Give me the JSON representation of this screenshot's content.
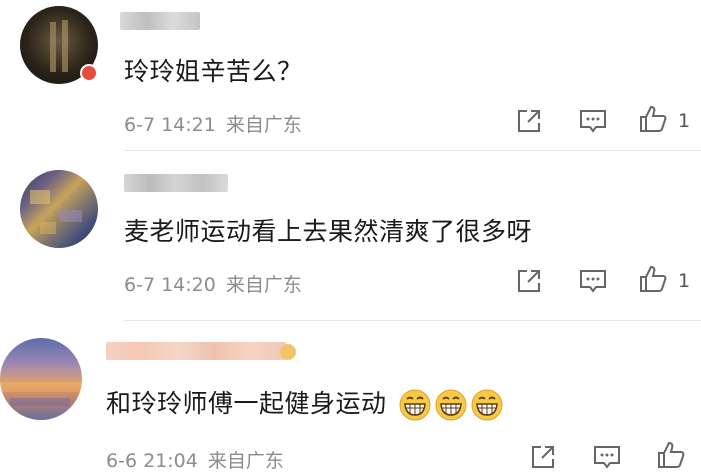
{
  "comments": [
    {
      "text": "玲玲姐辛苦么？",
      "date": "6-7 14:21",
      "location": "来自广东",
      "like_count": "1"
    },
    {
      "text": "麦老师运动看上去果然清爽了很多呀",
      "date": "6-7 14:20",
      "location": "来自广东",
      "like_count": "1"
    },
    {
      "text": "和玲玲师傅一起健身运动",
      "date": "6-6 21:04",
      "location": "来自广东",
      "like_count": ""
    }
  ],
  "icons": {
    "share": "share-icon",
    "reply": "comment-icon",
    "like": "thumbs-up-icon",
    "emoji": "grinning-face-emoji"
  }
}
